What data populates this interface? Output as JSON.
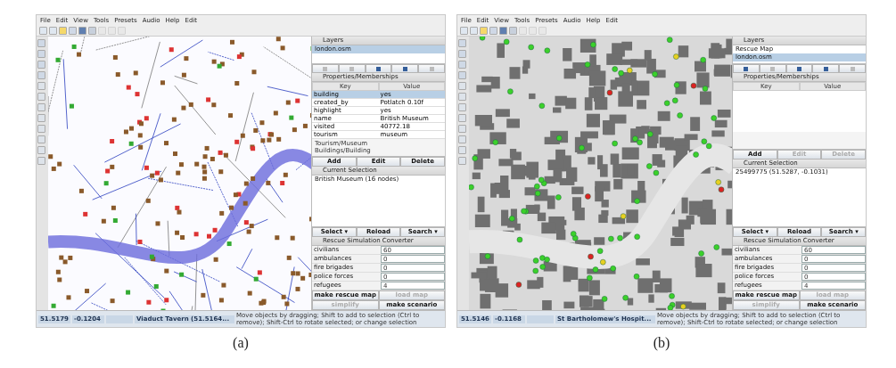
{
  "screenshots": [
    {
      "caption": "(a)",
      "kind": "detailed",
      "menu": [
        "File",
        "Edit",
        "View",
        "Tools",
        "Presets",
        "Audio",
        "Help",
        "Edit"
      ],
      "layers_title": "Layers",
      "layers": [
        {
          "name": "london.osm",
          "selected": true
        }
      ],
      "layer_buttons": [
        {
          "disabled": true
        },
        {
          "disabled": true
        },
        {
          "disabled": false
        },
        {
          "disabled": false
        },
        {
          "disabled": true
        }
      ],
      "properties": {
        "title": "Properties/Memberships",
        "columns": [
          "Key",
          "Value"
        ],
        "rows": [
          {
            "key": "building",
            "value": "yes",
            "selected": true
          },
          {
            "key": "created_by",
            "value": "Potlatch 0.10f",
            "selected": false
          },
          {
            "key": "highlight",
            "value": "yes",
            "selected": false
          },
          {
            "key": "name",
            "value": "British Museum",
            "selected": false
          },
          {
            "key": "visited",
            "value": "40772.18",
            "selected": false
          },
          {
            "key": "tourism",
            "value": "museum",
            "selected": false
          }
        ],
        "memberships": [
          "Tourism/Museum",
          "Buildings/Building"
        ],
        "buttons": [
          {
            "label": "Add",
            "disabled": false
          },
          {
            "label": "Edit",
            "disabled": false
          },
          {
            "label": "Delete",
            "disabled": false
          }
        ]
      },
      "selection_title": "Current Selection",
      "selection": [
        "British Museum (16 nodes)"
      ],
      "selection_buttons": [
        "Select ▾",
        "Reload",
        "Search ▾"
      ],
      "converter": {
        "title": "Rescue Simulation Converter",
        "fields": [
          {
            "label": "civilians",
            "value": "60"
          },
          {
            "label": "ambulances",
            "value": "0"
          },
          {
            "label": "fire brigades",
            "value": "0"
          },
          {
            "label": "police forces",
            "value": "0"
          },
          {
            "label": "refugees",
            "value": "4"
          }
        ],
        "buttons": [
          {
            "label": "make rescue map",
            "disabled": false
          },
          {
            "label": "load map",
            "disabled": true
          },
          {
            "label": "simplify",
            "disabled": true
          },
          {
            "label": "make scenario",
            "disabled": false
          }
        ]
      },
      "status": {
        "lat": "51.5179",
        "lon": "-0.1204",
        "object": "Viaduct Tavern (51.5164...",
        "hint": "Move objects by dragging; Shift to add to selection (Ctrl to remove); Shift-Ctrl to rotate selected; or change selection"
      }
    },
    {
      "caption": "(b)",
      "kind": "buildings",
      "menu": [
        "File",
        "Edit",
        "View",
        "Tools",
        "Presets",
        "Audio",
        "Help",
        "Edit"
      ],
      "layers_title": "Layers",
      "layers": [
        {
          "name": "Rescue Map",
          "selected": false
        },
        {
          "name": "london.osm",
          "selected": true
        }
      ],
      "layer_buttons": [
        {
          "disabled": false
        },
        {
          "disabled": true
        },
        {
          "disabled": false
        },
        {
          "disabled": false
        },
        {
          "disabled": true
        }
      ],
      "properties": {
        "title": "Properties/Memberships",
        "columns": [
          "Key",
          "Value"
        ],
        "buttons": [
          {
            "label": "Add",
            "disabled": false
          },
          {
            "label": "Edit",
            "disabled": true
          },
          {
            "label": "Delete",
            "disabled": true
          }
        ]
      },
      "selection_title": "Current Selection",
      "selection": [
        "25499775 (51.5287, -0.1031)"
      ],
      "selection_buttons": [
        "Select ▾",
        "Reload",
        "Search ▾"
      ],
      "converter": {
        "title": "Rescue Simulation Converter",
        "fields": [
          {
            "label": "civilians",
            "value": "60"
          },
          {
            "label": "ambulances",
            "value": "0"
          },
          {
            "label": "fire brigades",
            "value": "0"
          },
          {
            "label": "police forces",
            "value": "0"
          },
          {
            "label": "refugees",
            "value": "4"
          }
        ],
        "buttons": [
          {
            "label": "make rescue map",
            "disabled": false
          },
          {
            "label": "load map",
            "disabled": true
          },
          {
            "label": "simplify",
            "disabled": true
          },
          {
            "label": "make scenario",
            "disabled": false
          }
        ]
      },
      "status": {
        "lat": "51.5146",
        "lon": "-0.1168",
        "object": "St Bartholomew's Hospit...",
        "hint": "Move objects by dragging; Shift to add to selection (Ctrl to remove); Shift-Ctrl to rotate selected; or change selection"
      }
    }
  ]
}
